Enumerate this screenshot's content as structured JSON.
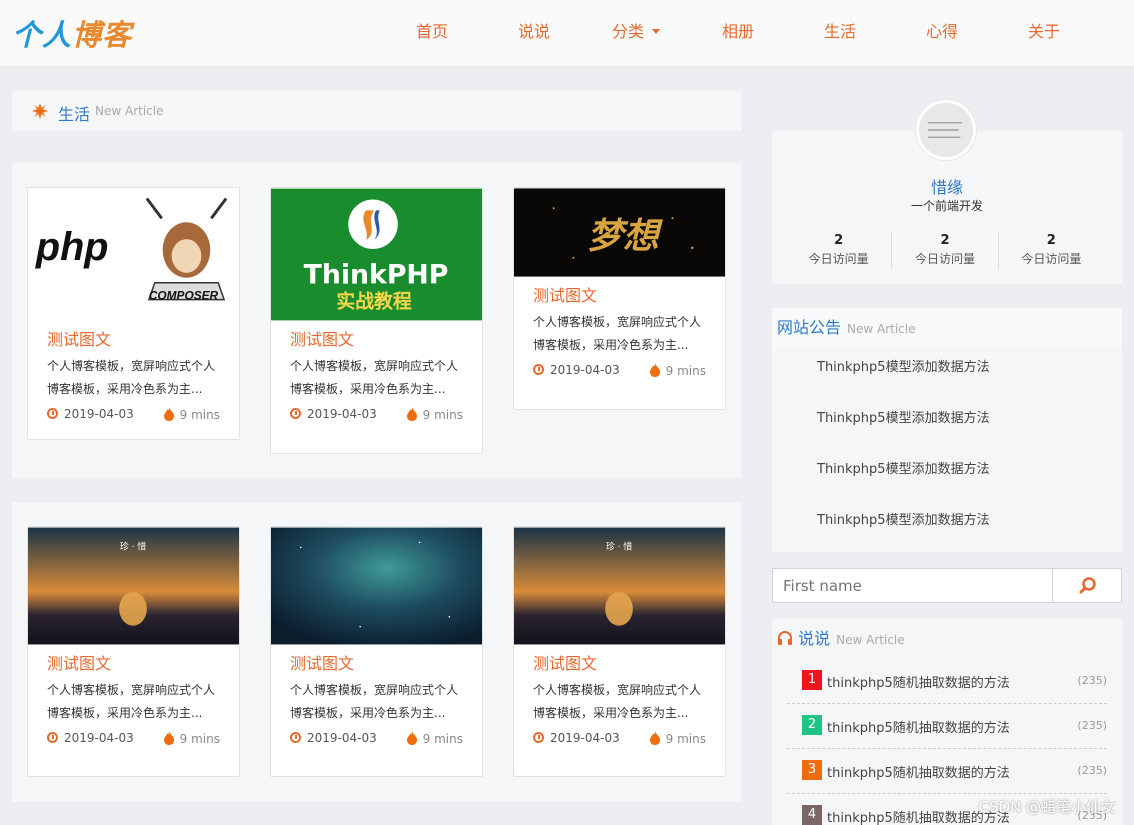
{
  "logo": {
    "part1": "个人",
    "part2": "博客"
  },
  "nav": [
    {
      "label": "首页"
    },
    {
      "label": "说说"
    },
    {
      "label": "分类",
      "dropdown": true
    },
    {
      "label": "相册"
    },
    {
      "label": "生活"
    },
    {
      "label": "心得"
    },
    {
      "label": "关于"
    }
  ],
  "section": {
    "title": "生活",
    "subtitle": "New Article",
    "icon": "sun-icon"
  },
  "cards": [
    {
      "title": "测试图文",
      "desc": "个人博客模板，宽屏响应式个人博客模板，采用冷色系为主...",
      "date": "2019-04-03",
      "mins": "9 mins",
      "img_text": "php",
      "img_sub": "COMPOSER"
    },
    {
      "title": "测试图文",
      "desc": "个人博客模板，宽屏响应式个人博客模板，采用冷色系为主...",
      "date": "2019-04-03",
      "mins": "9 mins",
      "img_text": "ThinkPHP",
      "img_sub": "实战教程"
    },
    {
      "title": "测试图文",
      "desc": "个人博客模板，宽屏响应式个人博客模板，采用冷色系为主...",
      "date": "2019-04-03",
      "mins": "9 mins",
      "img_text": "梦想"
    },
    {
      "title": "测试图文",
      "desc": "个人博客模板，宽屏响应式个人博客模板，采用冷色系为主...",
      "date": "2019-04-03",
      "mins": "9 mins",
      "img_text": "珍 · 惜"
    },
    {
      "title": "测试图文",
      "desc": "个人博客模板，宽屏响应式个人博客模板，采用冷色系为主...",
      "date": "2019-04-03",
      "mins": "9 mins"
    },
    {
      "title": "测试图文",
      "desc": "个人博客模板，宽屏响应式个人博客模板，采用冷色系为主...",
      "date": "2019-04-03",
      "mins": "9 mins",
      "img_text": "珍 · 惜"
    }
  ],
  "profile": {
    "name": "惜缘",
    "desc": "一个前端开发",
    "stats": [
      {
        "value": "2",
        "label": "今日访问量"
      },
      {
        "value": "2",
        "label": "今日访问量"
      },
      {
        "value": "2",
        "label": "今日访问量"
      }
    ]
  },
  "notice": {
    "title": "网站公告",
    "subtitle": "New Article",
    "items": [
      "Thinkphp5模型添加数据方法",
      "Thinkphp5模型添加数据方法",
      "Thinkphp5模型添加数据方法",
      "Thinkphp5模型添加数据方法"
    ]
  },
  "search": {
    "placeholder": "First name",
    "icon": "search-icon"
  },
  "talk": {
    "title": "说说",
    "subtitle": "New Article",
    "icon": "headphones-icon",
    "items": [
      {
        "num": "1",
        "text": "thinkphp5随机抽取数据的方法",
        "count": "(235)",
        "color": "#f0141e"
      },
      {
        "num": "2",
        "text": "thinkphp5随机抽取数据的方法",
        "count": "(235)",
        "color": "#1dc483"
      },
      {
        "num": "3",
        "text": "thinkphp5随机抽取数据的方法",
        "count": "(235)",
        "color": "#f06c0c"
      },
      {
        "num": "4",
        "text": "thinkphp5随机抽取数据的方法",
        "count": "(235)",
        "color": "#7c6767"
      }
    ]
  },
  "watermark": "CSDN @蜡笔小仙女",
  "colors": {
    "accent": "#e8692e",
    "link": "#2d7bc8"
  }
}
